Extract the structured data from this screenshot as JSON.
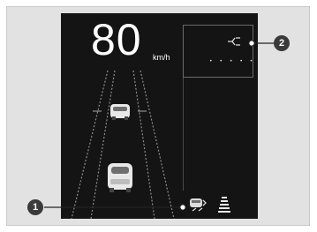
{
  "display": {
    "speed": "80",
    "unit": "km/h"
  },
  "callouts": [
    {
      "number": "1"
    },
    {
      "number": "2"
    }
  ],
  "icons": [
    "road-lane-icon",
    "vehicle-ahead-icon",
    "following-distance-icon",
    "lane-keep-status-icon",
    "signal-link-icon"
  ]
}
